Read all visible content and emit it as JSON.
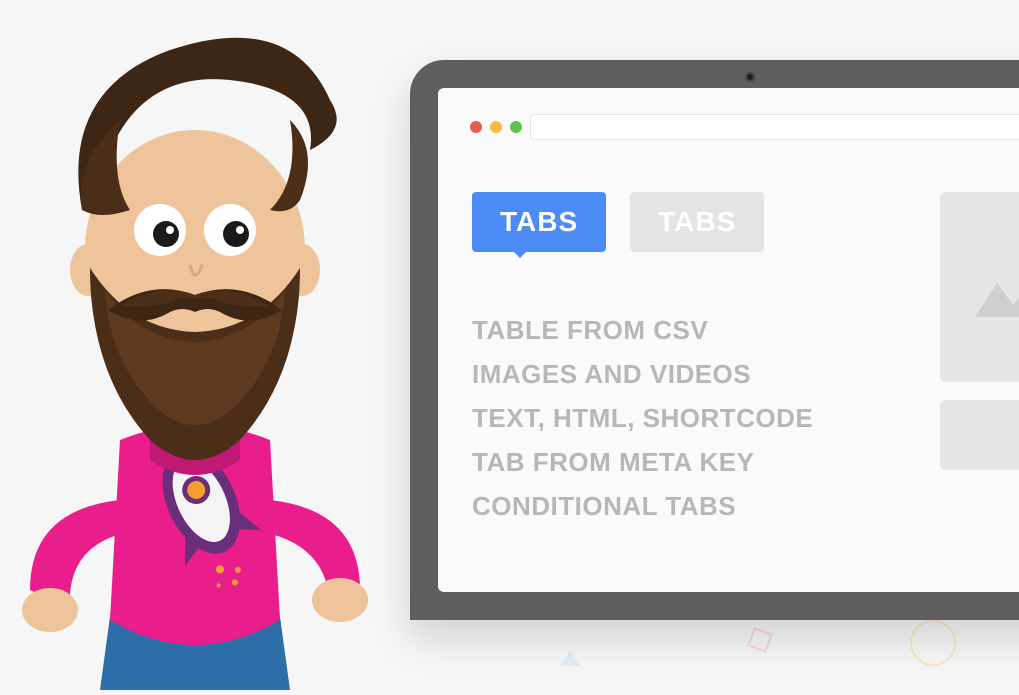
{
  "tabs": {
    "active_label": "TABS",
    "inactive_label": "TABS"
  },
  "features": {
    "line1": "TABLE FROM CSV",
    "line2": "IMAGES AND VIDEOS",
    "line3": "TEXT, HTML, SHORTCODE",
    "line4": "TAB FROM META KEY",
    "line5": "CONDITIONAL TABS"
  }
}
